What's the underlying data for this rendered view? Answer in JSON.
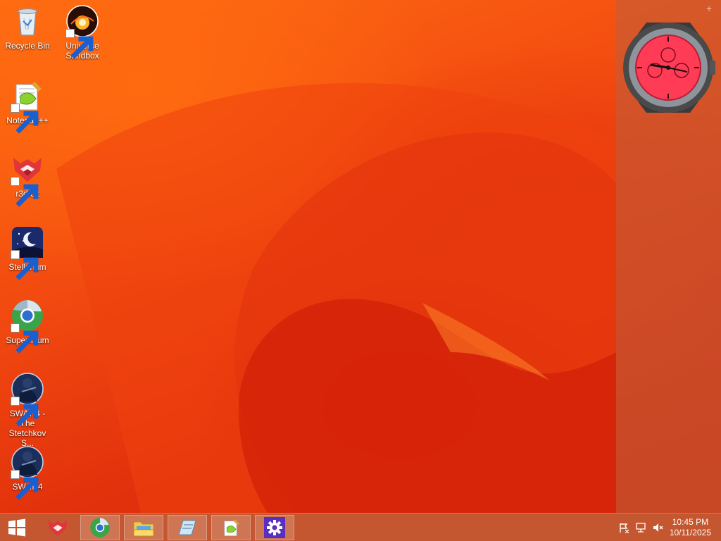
{
  "desktop_icons": [
    {
      "label": "Recycle Bin",
      "icon": "recycle-bin-icon"
    },
    {
      "label": "Universe Sandbox",
      "icon": "universe-sandbox-icon"
    },
    {
      "label": "Notepad++",
      "icon": "notepad-plus-plus-icon"
    },
    {
      "label": "r3dfox",
      "icon": "r3dfox-icon"
    },
    {
      "label": "Stellarium",
      "icon": "stellarium-icon"
    },
    {
      "label": "Supermium",
      "icon": "supermium-icon"
    },
    {
      "label": "SWAT 4 - The Stetchkov S...",
      "icon": "swat4-icon"
    },
    {
      "label": "SWAT 4",
      "icon": "swat4-icon"
    }
  ],
  "taskbar": {
    "start_icon": "windows-start-icon",
    "buttons": [
      "r3dfox-icon",
      "supermium-icon",
      "file-explorer-icon",
      "notepad-icon",
      "notepad-plus-plus-icon",
      "settings-gear-icon"
    ]
  },
  "tray": {
    "icons": [
      "action-center-flag-icon",
      "network-icon",
      "volume-muted-icon"
    ],
    "time": "10:45 PM",
    "date": "10/11/2025"
  },
  "colors": {
    "taskbar": "#c4572f",
    "watch_face": "#ff3b56",
    "settings_tile": "#5a2fbf"
  }
}
